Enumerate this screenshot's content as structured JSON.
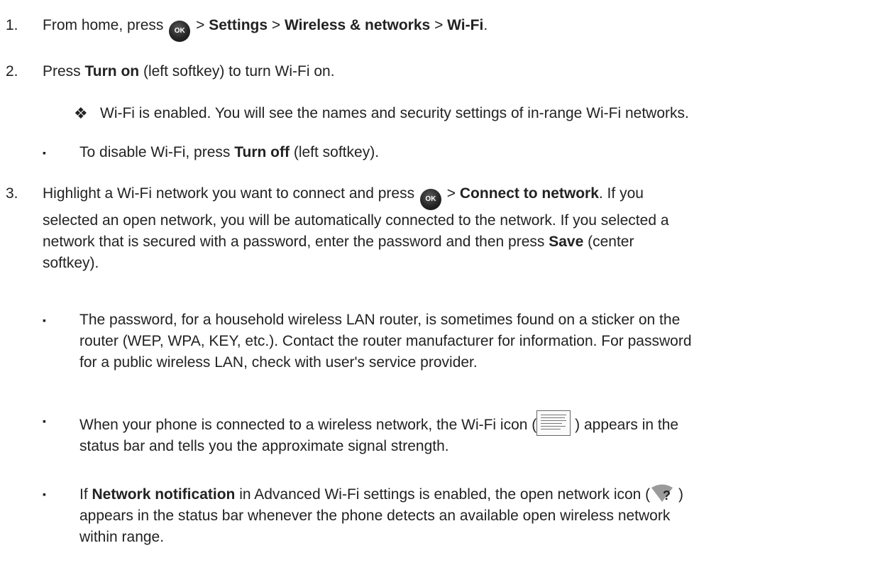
{
  "step1": {
    "num": "1.",
    "before": "From home, press",
    "ok_icon": "ok-button-icon",
    "ok_text": "OK",
    "gt1": ">",
    "settings": "Settings",
    "gt2": ">",
    "wireless": "Wireless & networks",
    "gt3": ">",
    "wifi": "Wi-Fi",
    "end": "."
  },
  "step2": {
    "num": "2.",
    "press": "Press",
    "turn_on": "Turn on",
    "rest": "(left softkey) to turn Wi-Fi on.",
    "result_bullet": "❖",
    "result": "Wi-Fi is enabled. You will see the names and security settings of in-range Wi-Fi networks.",
    "disable_bullet": "▪",
    "disable_before": "To disable Wi-Fi, press",
    "turn_off": "Turn off",
    "disable_after": "(left softkey)."
  },
  "step3": {
    "num": "3.",
    "line1_before": "Highlight a Wi-Fi network you want to connect and press",
    "ok_text": "OK",
    "gt": ">",
    "connect": "Connect to network",
    "line1_after": ". If you",
    "line2": "selected an open network, you will be automatically connected to the network. If you selected a",
    "line3_before": "network that is secured with a password, enter the password and then press",
    "save": "Save",
    "line3_after": "(center",
    "line4": "softkey).",
    "bullet": "▪",
    "pw_line1": "The password, for a household wireless LAN router, is sometimes found on a sticker on the",
    "pw_line2": "router (WEP, WPA, KEY, etc.). Contact the router manufacturer for information. For password",
    "pw_line3": "for a public wireless LAN, check with user's service provider.",
    "conn_before": "When your phone is connected to a wireless network, the Wi-Fi icon (",
    "wifi_icon": "wifi-connected-icon",
    "conn_after": ") appears in the",
    "conn_line2": "status bar and tells you the approximate signal strength.",
    "notif_if": "If",
    "notif_bold": "Network notification",
    "notif_mid": "in Advanced Wi-Fi settings is enabled, the open network icon (",
    "open_icon": "open-network-icon",
    "notif_after": ")",
    "notif_line2": "appears in the status bar whenever the phone detects an available open wireless network",
    "notif_line3": "within range."
  }
}
